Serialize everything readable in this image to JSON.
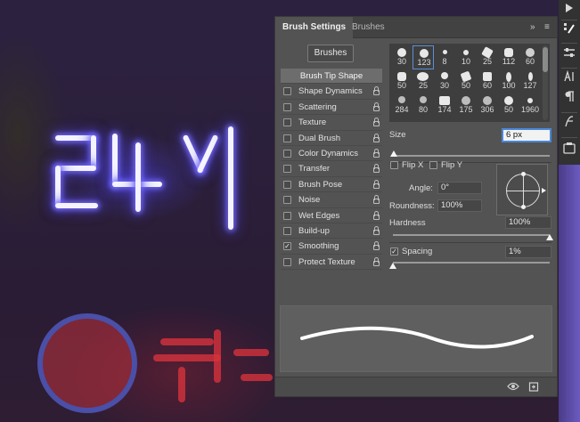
{
  "panel": {
    "tabs": [
      {
        "label": "Brush Settings",
        "active": true
      },
      {
        "label": "Brushes",
        "active": false
      }
    ],
    "collapse_glyph": "»",
    "menu_glyph": "≡",
    "brushes_button": "Brushes",
    "options": [
      {
        "label": "Brush Tip Shape",
        "header": true
      },
      {
        "label": "Shape Dynamics",
        "checked": false
      },
      {
        "label": "Scattering",
        "checked": false
      },
      {
        "label": "Texture",
        "checked": false
      },
      {
        "label": "Dual Brush",
        "checked": false
      },
      {
        "label": "Color Dynamics",
        "checked": false
      },
      {
        "label": "Transfer",
        "checked": false
      },
      {
        "label": "Brush Pose",
        "checked": false
      },
      {
        "label": "Noise",
        "checked": false
      },
      {
        "label": "Wet Edges",
        "checked": false
      },
      {
        "label": "Build-up",
        "checked": false
      },
      {
        "label": "Smoothing",
        "checked": true
      },
      {
        "label": "Protect Texture",
        "checked": false
      }
    ],
    "brush_presets": [
      {
        "size": "30"
      },
      {
        "size": "123",
        "selected": true
      },
      {
        "size": "8"
      },
      {
        "size": "10"
      },
      {
        "size": "25"
      },
      {
        "size": "112"
      },
      {
        "size": "60"
      },
      {
        "size": "50"
      },
      {
        "size": "25"
      },
      {
        "size": "30"
      },
      {
        "size": "50"
      },
      {
        "size": "60"
      },
      {
        "size": "100"
      },
      {
        "size": "127"
      },
      {
        "size": "284"
      },
      {
        "size": "80"
      },
      {
        "size": "174"
      },
      {
        "size": "175"
      },
      {
        "size": "306"
      },
      {
        "size": "50"
      },
      {
        "size": "1960"
      }
    ],
    "size": {
      "label": "Size",
      "value": "6 px"
    },
    "flip_x": {
      "label": "Flip X",
      "checked": false
    },
    "flip_y": {
      "label": "Flip Y",
      "checked": false
    },
    "angle": {
      "label": "Angle:",
      "value": "0°"
    },
    "roundness": {
      "label": "Roundness:",
      "value": "100%"
    },
    "hardness": {
      "label": "Hardness",
      "value": "100%",
      "fraction": 1.0
    },
    "spacing": {
      "label": "Spacing",
      "value": "1%",
      "checked": true,
      "fraction": 0.0
    }
  },
  "colors": {
    "panel_bg": "#535353",
    "accent_blue": "#4a87d9",
    "neon_white": "#f4f3ff",
    "neon_red": "#d6323c"
  },
  "toolbar_icons": [
    "play-icon",
    "brush-settings-icon",
    "adjustments-icon",
    "character-icon",
    "paragraph-icon",
    "glyphs-icon",
    "libraries-icon"
  ]
}
